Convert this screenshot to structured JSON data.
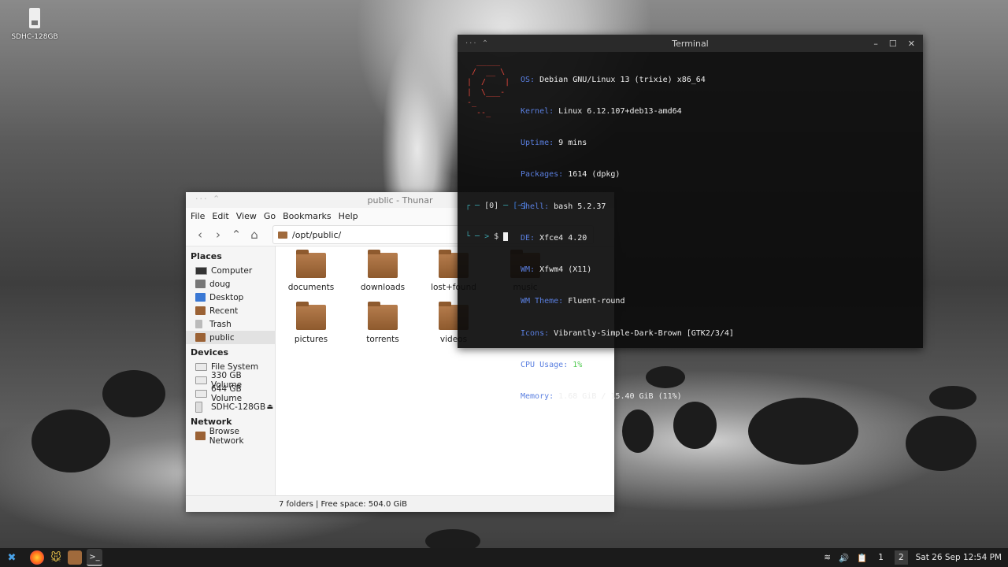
{
  "desktop": {
    "icons": [
      {
        "label": "SDHC-128GB"
      }
    ]
  },
  "thunar": {
    "title": "public - Thunar",
    "menu": [
      "File",
      "Edit",
      "View",
      "Go",
      "Bookmarks",
      "Help"
    ],
    "path": "/opt/public/",
    "sidebar": {
      "places_heading": "Places",
      "places": [
        "Computer",
        "doug",
        "Desktop",
        "Recent",
        "Trash",
        "public"
      ],
      "devices_heading": "Devices",
      "devices": [
        "File System",
        "330 GB Volume",
        "644 GB Volume",
        "SDHC-128GB"
      ],
      "network_heading": "Network",
      "network": [
        "Browse Network"
      ]
    },
    "folders": [
      "documents",
      "downloads",
      "lost+found",
      "music",
      "pictures",
      "torrents",
      "videos"
    ],
    "status": "7 folders  |  Free space: 504.0 GiB"
  },
  "terminal": {
    "title": "Terminal",
    "ascii_logo": "  _____\n /  __ \\\n|  /    |\n|  \\___-\n-_\n  --_",
    "info": [
      {
        "key": "OS",
        "value": "Debian GNU/Linux 13 (trixie) x86_64"
      },
      {
        "key": "Kernel",
        "value": "Linux 6.12.107+deb13-amd64"
      },
      {
        "key": "Uptime",
        "value": "9 mins"
      },
      {
        "key": "Packages",
        "value": "1614 (dpkg)"
      },
      {
        "key": "Shell",
        "value": "bash 5.2.37"
      },
      {
        "key": "DE",
        "value": "Xfce4 4.20"
      },
      {
        "key": "WM",
        "value": "Xfwm4 (X11)"
      },
      {
        "key": "WM Theme",
        "value": "Fluent-round"
      },
      {
        "key": "Icons",
        "value": "Vibrantly-Simple-Dark-Brown [GTK2/3/4]"
      },
      {
        "key": "CPU Usage",
        "value": "1%"
      },
      {
        "key": "Memory",
        "value": "1.68 GiB / 15.40 GiB (11%)"
      }
    ],
    "prompt_line1_status": "[0]",
    "prompt_line1_dir": "[~]",
    "prompt_line2": "$"
  },
  "taskbar": {
    "workspaces": [
      "1",
      "2"
    ],
    "clock": "Sat 26 Sep 12:54 PM"
  }
}
